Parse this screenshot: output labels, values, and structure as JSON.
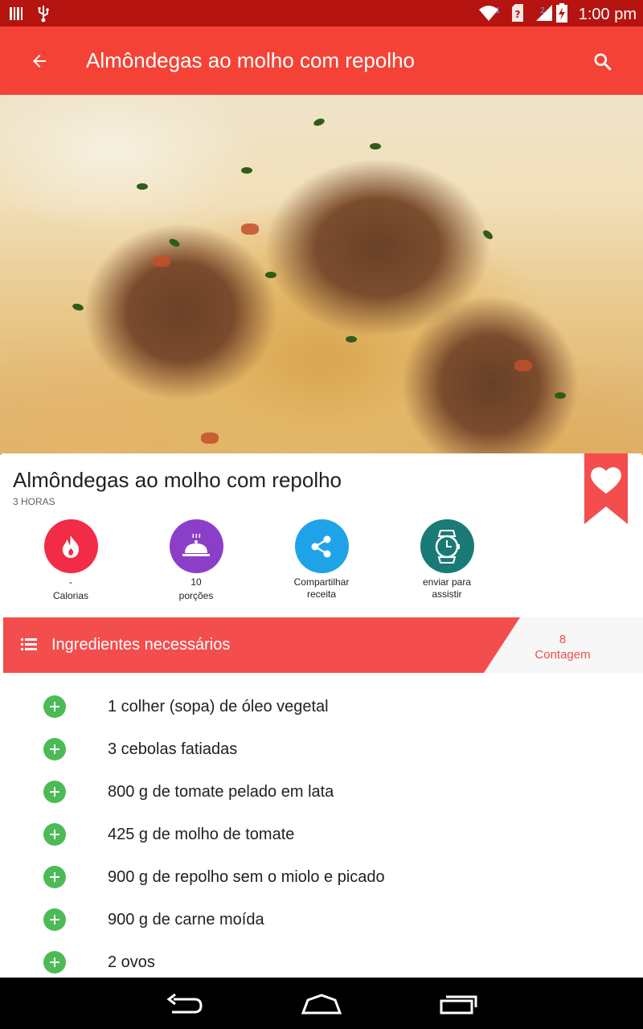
{
  "status_bar": {
    "time": "1:00 pm",
    "sim1_badge": "1",
    "sim2_badge": "2",
    "icons": [
      "barcode-icon",
      "usb-icon",
      "wifi-icon",
      "sim-unknown-icon",
      "signal-icon",
      "battery-charging-icon"
    ]
  },
  "app_bar": {
    "title": "Almôndegas ao molho com repolho",
    "back_icon": "arrow-back-icon",
    "search_icon": "search-icon"
  },
  "recipe": {
    "title": "Almôndegas ao molho com repolho",
    "time": "3 HORAS",
    "favorite_icon": "heart-bookmark-icon"
  },
  "actions": [
    {
      "value": "-",
      "label": "Calorias",
      "icon": "flame-icon",
      "color": "#f22b46"
    },
    {
      "value": "10",
      "label": "porções",
      "icon": "food-cloche-icon",
      "color": "#8b3fc9"
    },
    {
      "value": "Compartilhar",
      "label": "receita",
      "icon": "share-icon",
      "color": "#1fa3e8"
    },
    {
      "value": "enviar para",
      "label": "assistir",
      "icon": "watch-icon",
      "color": "#1a7a76"
    }
  ],
  "ingredients_header": {
    "label": "Ingredientes necessários",
    "count": "8",
    "count_label": "Contagem",
    "band_color": "#f44d4d"
  },
  "ingredients": [
    "1 colher (sopa) de óleo vegetal",
    "3 cebolas fatiadas",
    "800 g de tomate pelado em lata",
    "425 g de molho de tomate",
    "900 g de repolho sem o miolo e picado",
    "900 g de carne moída",
    "2 ovos"
  ],
  "nav_bar": {
    "buttons": [
      "back-nav-icon",
      "home-nav-icon",
      "recents-nav-icon"
    ]
  }
}
